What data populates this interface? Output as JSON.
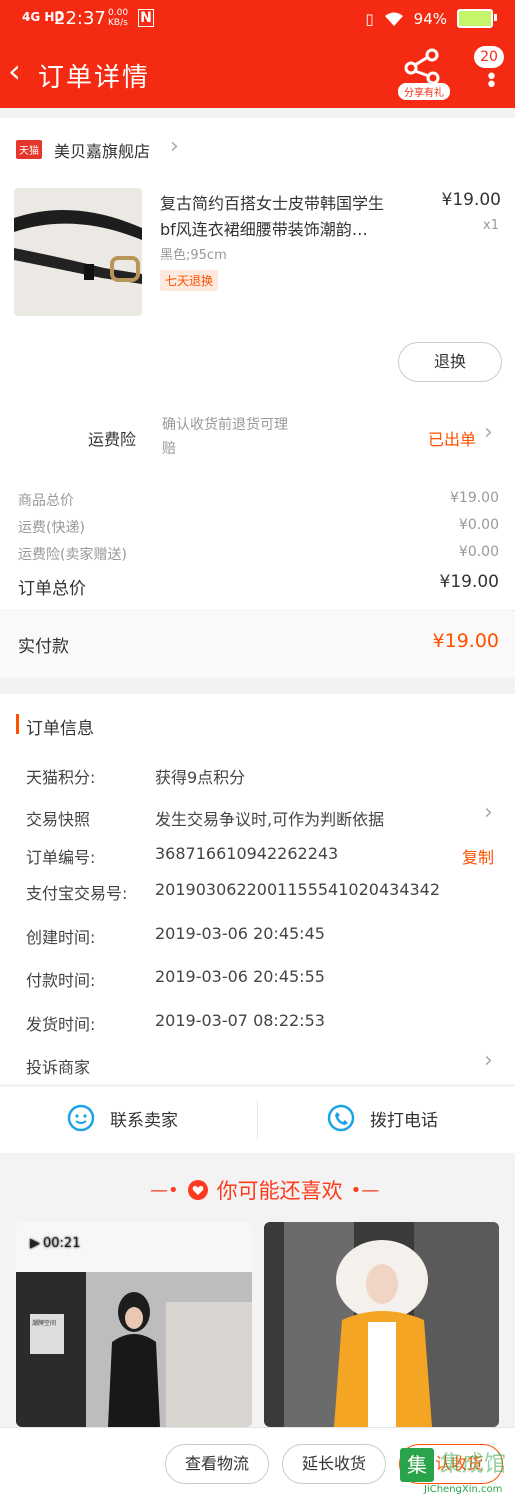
{
  "status": {
    "signal": "4G HD",
    "time": "22:37",
    "speed": "0.00 KB/s",
    "battery": "94%"
  },
  "header": {
    "title": "订单详情",
    "share_label": "分享有礼",
    "badge": "20"
  },
  "shop": {
    "tag": "天猫",
    "name": "美贝嘉旗舰店"
  },
  "product": {
    "title_line1": "复古简约百搭女士皮带韩国学生",
    "title_line2": "bf风连衣裙细腰带装饰潮韵…",
    "sku": "黑色;95cm",
    "price": "¥19.00",
    "qty": "x1",
    "badge": "七天退换",
    "refund_button": "退换"
  },
  "insurance": {
    "label": "运费险",
    "desc_line1": "确认收货前退货可理",
    "desc_line2": "赔",
    "status": "已出单"
  },
  "summary": {
    "rows": [
      {
        "label": "商品总价",
        "value": "¥19.00"
      },
      {
        "label": "运费(快递)",
        "value": "¥0.00"
      },
      {
        "label": "运费险(卖家赠送)",
        "value": "¥0.00"
      }
    ],
    "total_label": "订单总价",
    "total_value": "¥19.00",
    "paid_label": "实付款",
    "paid_value": "¥19.00"
  },
  "order_info": {
    "title": "订单信息",
    "points_label": "天猫积分:",
    "points_value": "获得9点积分",
    "snapshot_label": "交易快照",
    "snapshot_value": "发生交易争议时,可作为判断依据",
    "order_no_label": "订单编号:",
    "order_no_value": "368716610942262243",
    "copy_label": "复制",
    "alipay_label": "支付宝交易号:",
    "alipay_value": "2019030622001155541020434342",
    "created_label": "创建时间:",
    "created_value": "2019-03-06 20:45:45",
    "paid_time_label": "付款时间:",
    "paid_time_value": "2019-03-06 20:45:55",
    "shipped_label": "发货时间:",
    "shipped_value": "2019-03-07 08:22:53",
    "complain_label": "投诉商家"
  },
  "contact": {
    "seller_label": "联系卖家",
    "call_label": "拨打电话"
  },
  "recommend": {
    "title": "你可能还喜欢",
    "video_time": "00:21",
    "store_sign": "潮牌空间"
  },
  "bottom": {
    "logistics": "查看物流",
    "extend": "延长收货",
    "confirm": "确认收货"
  },
  "watermark": {
    "cn": "集成馆",
    "url": "JiChengXin.com"
  },
  "colors": {
    "brand": "#f42b12",
    "accent": "#ff5000"
  }
}
